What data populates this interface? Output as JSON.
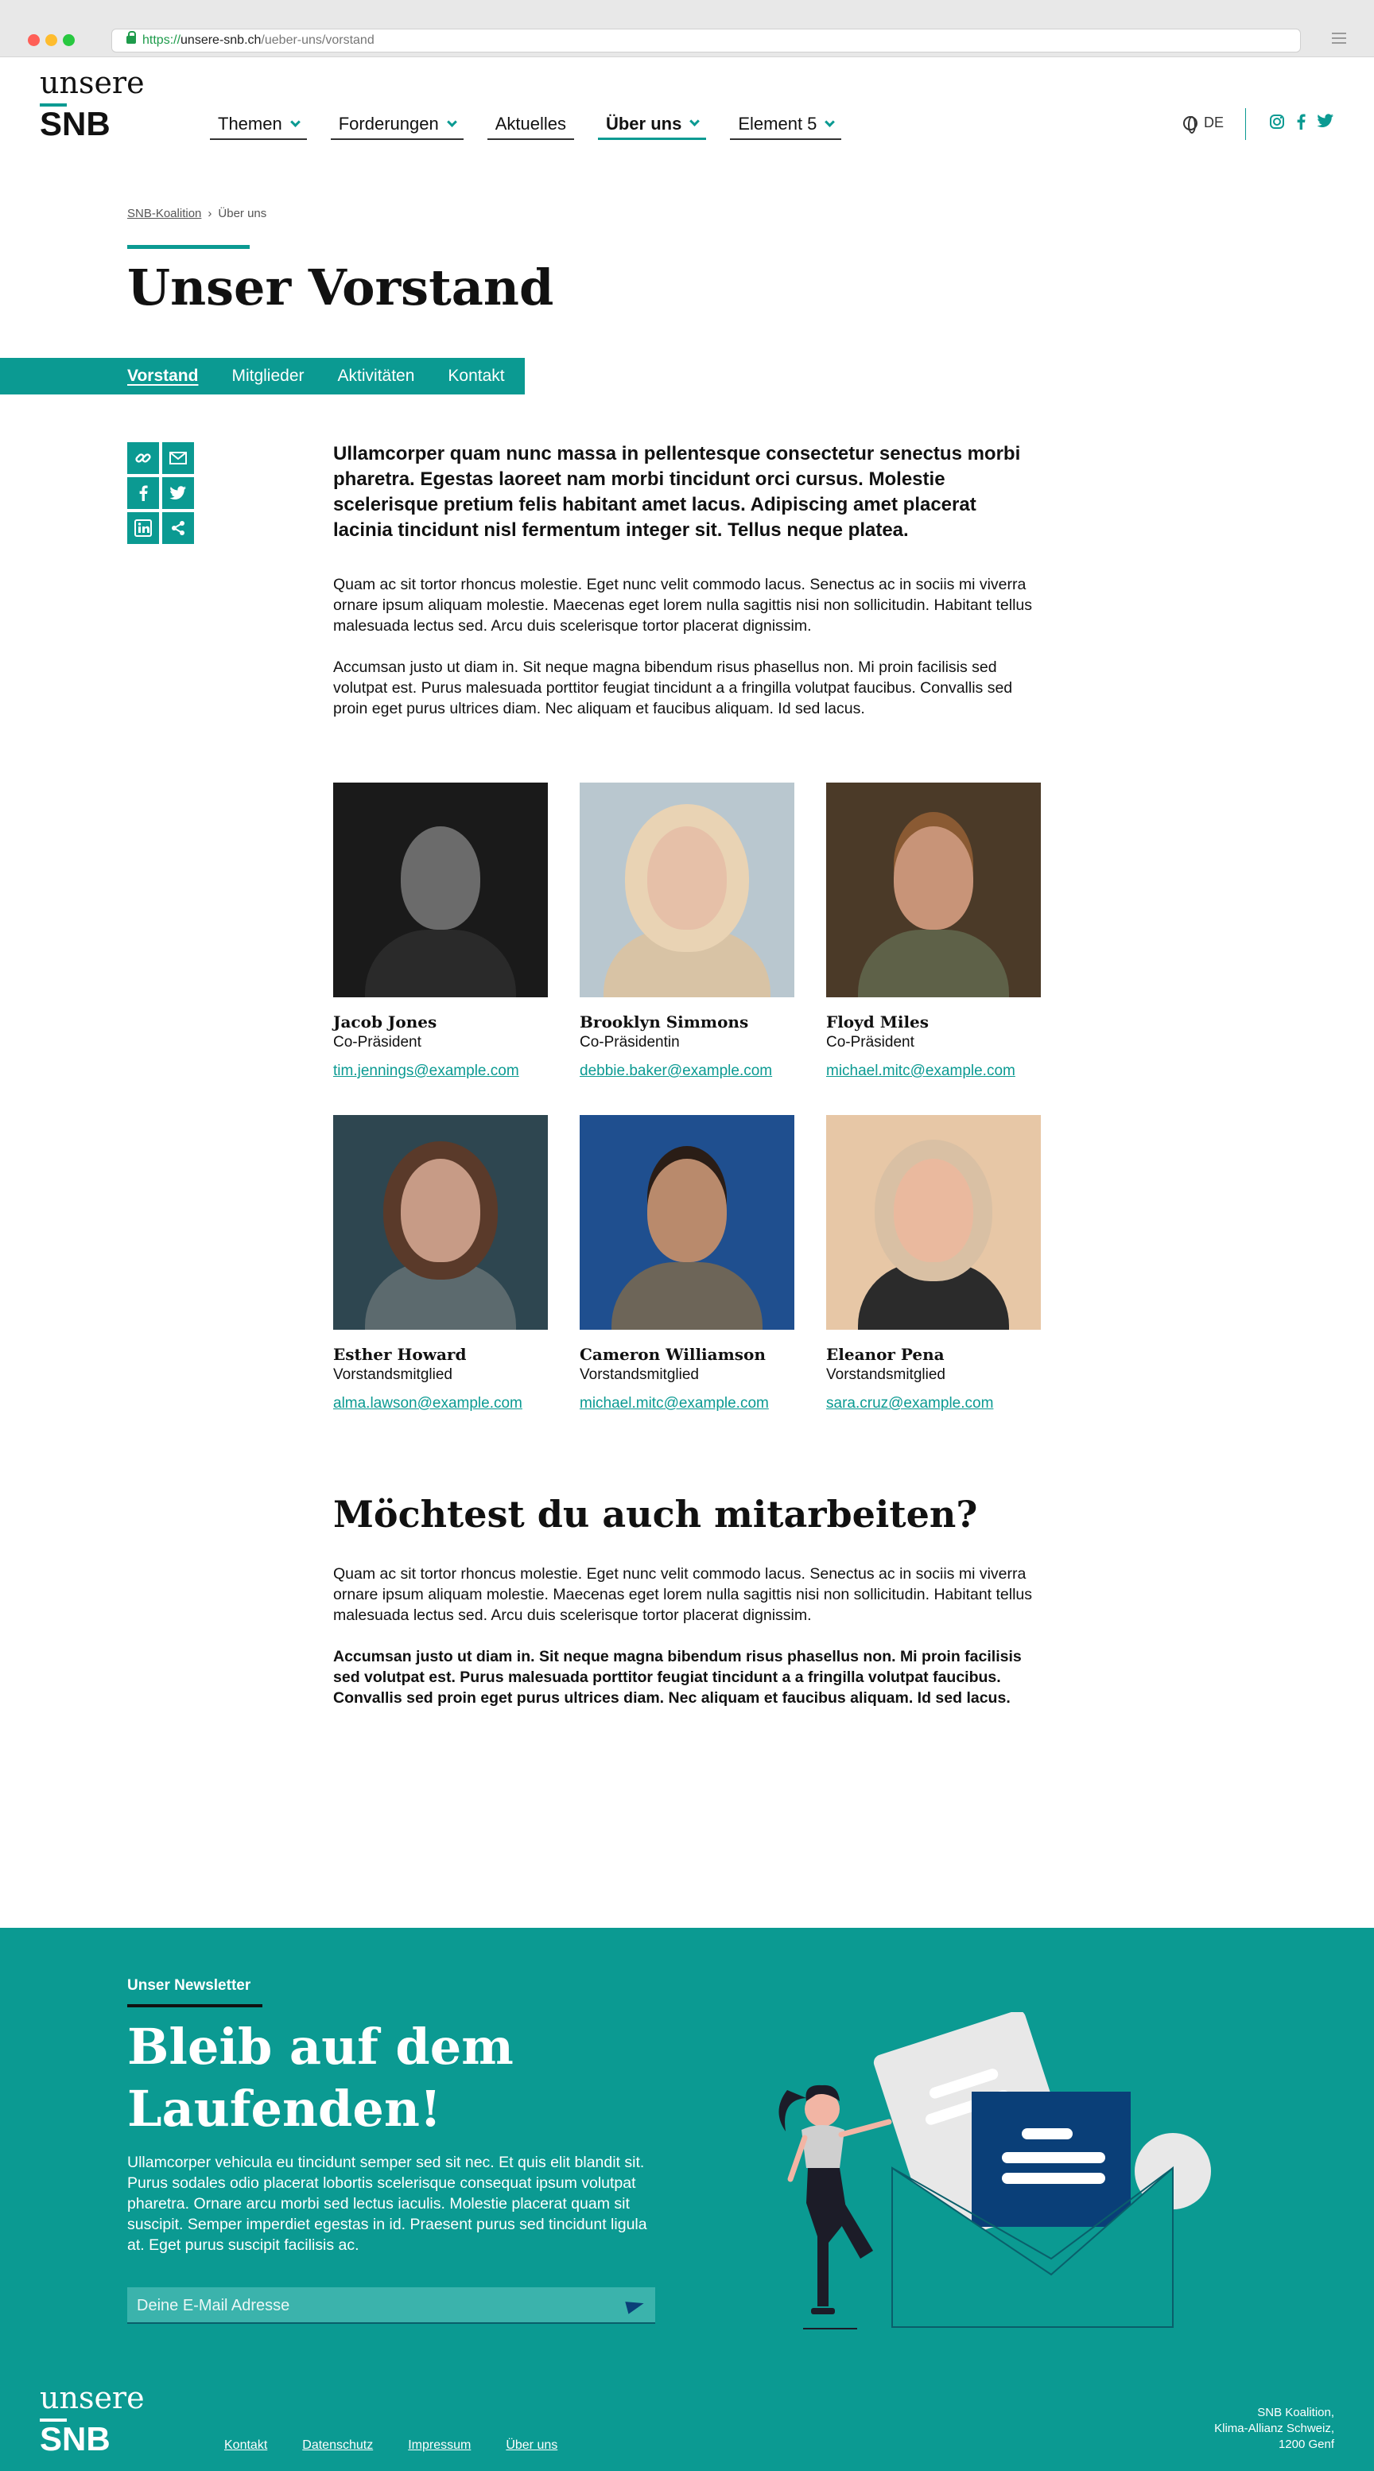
{
  "browser": {
    "url_protocol": "https://",
    "url_host": "unsere-snb.ch",
    "url_path": "/ueber-uns/vorstand"
  },
  "header": {
    "logo_line1": "unsere",
    "logo_line2": "SNB",
    "nav": [
      {
        "label": "Themen",
        "dropdown": true,
        "active": false
      },
      {
        "label": "Forderungen",
        "dropdown": true,
        "active": false
      },
      {
        "label": "Aktuelles",
        "dropdown": false,
        "active": false
      },
      {
        "label": "Über uns",
        "dropdown": true,
        "active": true
      },
      {
        "label": "Element 5",
        "dropdown": true,
        "active": false
      }
    ],
    "language": "DE",
    "social_icons": [
      "instagram-icon",
      "facebook-icon",
      "twitter-icon"
    ]
  },
  "breadcrumb": {
    "home": "SNB-Koalition",
    "separator": "›",
    "current": "Über uns"
  },
  "page": {
    "title": "Unser Vorstand",
    "subnav": [
      "Vorstand",
      "Mitglieder",
      "Aktivitäten",
      "Kontakt"
    ],
    "share_icons": [
      "link-icon",
      "mail-icon",
      "facebook-icon",
      "twitter-icon",
      "linkedin-icon",
      "share-icon"
    ],
    "lead": "Ullamcorper quam nunc massa in pellentesque consectetur senectus morbi pharetra. Egestas laoreet nam morbi tincidunt orci cursus. Molestie scelerisque pretium felis habitant amet lacus. Adipiscing amet placerat lacinia tincidunt nisl fermentum integer sit. Tellus neque platea.",
    "para1": "Quam ac sit tortor rhoncus molestie. Eget nunc velit commodo lacus. Senectus ac in sociis mi viverra ornare ipsum aliquam molestie. Maecenas eget lorem nulla sagittis nisi non sollicitudin. Habitant tellus malesuada lectus sed. Arcu duis scelerisque tortor placerat dignissim.",
    "para2": "Accumsan justo ut diam in. Sit neque magna bibendum risus phasellus non. Mi proin facilisis sed volutpat est. Purus malesuada porttitor feugiat tincidunt a a fringilla volutpat faucibus. Convallis sed proin eget purus ultrices diam. Nec aliquam et faucibus aliquam. Id sed lacus."
  },
  "team": [
    {
      "name": "Jacob Jones",
      "role": "Co-Präsident",
      "email": "tim.jennings@example.com"
    },
    {
      "name": "Brooklyn Simmons",
      "role": "Co-Präsidentin",
      "email": "debbie.baker@example.com"
    },
    {
      "name": "Floyd Miles",
      "role": "Co-Präsident",
      "email": "michael.mitc@example.com"
    },
    {
      "name": "Esther Howard",
      "role": "Vorstandsmitglied",
      "email": "alma.lawson@example.com"
    },
    {
      "name": "Cameron Williamson",
      "role": "Vorstandsmitglied",
      "email": "michael.mitc@example.com"
    },
    {
      "name": "Eleanor Pena",
      "role": "Vorstandsmitglied",
      "email": "sara.cruz@example.com"
    }
  ],
  "join": {
    "title": "Möchtest du auch mitarbeiten?",
    "para1": "Quam ac sit tortor rhoncus molestie. Eget nunc velit commodo lacus. Senectus ac in sociis mi viverra ornare ipsum aliquam molestie. Maecenas eget lorem nulla sagittis nisi non sollicitudin. Habitant tellus malesuada lectus sed. Arcu duis scelerisque tortor placerat dignissim.",
    "para2": "Accumsan justo ut diam in. Sit neque magna bibendum risus phasellus non. Mi proin facilisis sed volutpat est. Purus malesuada porttitor feugiat tincidunt a a fringilla volutpat faucibus. Convallis sed proin eget purus ultrices diam. Nec aliquam et faucibus aliquam. Id sed lacus."
  },
  "newsletter": {
    "kicker": "Unser Newsletter",
    "title": "Bleib auf dem Laufenden!",
    "text": "Ullamcorper vehicula eu tincidunt semper sed sit nec. Et quis elit blandit sit. Purus sodales odio placerat lobortis scelerisque consequat ipsum volutpat pharetra. Ornare arcu morbi sed lectus iaculis. Molestie placerat quam sit suscipit. Semper imperdiet egestas in id. Praesent purus sed tincidunt ligula at. Eget purus suscipit facilisis ac.",
    "email_placeholder": "Deine E-Mail Adresse"
  },
  "footer": {
    "logo_line1": "unsere",
    "logo_line2": "SNB",
    "links": [
      "Kontakt",
      "Datenschutz",
      "Impressum",
      "Über uns"
    ],
    "address_line1": "SNB Koalition,",
    "address_line2": "Klima-Allianz Schweiz,",
    "address_line3": "1200 Genf"
  },
  "colors": {
    "accent": "#0b9a92",
    "dark_blue": "#0a3f78"
  }
}
